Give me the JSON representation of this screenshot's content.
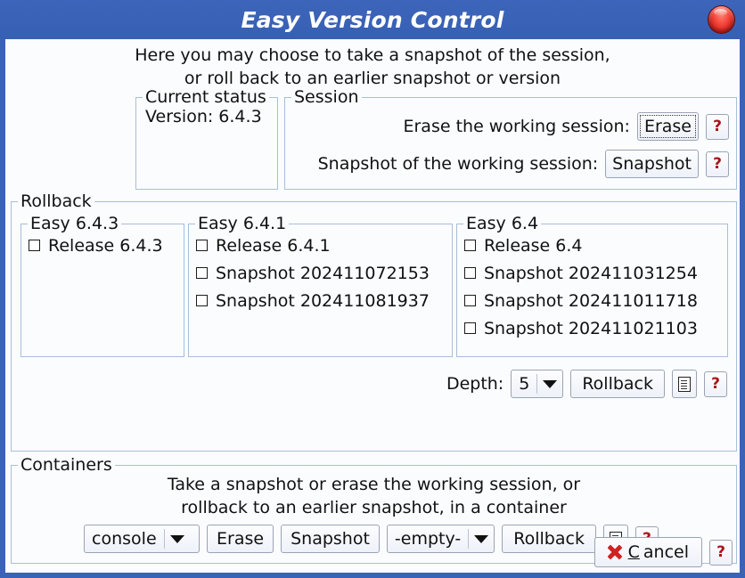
{
  "window": {
    "title": "Easy Version Control",
    "close_icon": "close-gem-icon"
  },
  "intro": {
    "line1": "Here you may choose to take a snapshot of the session,",
    "line2": "or roll back to an earlier snapshot or version"
  },
  "current_status": {
    "legend": "Current status",
    "version": "Version: 6.4.3"
  },
  "session": {
    "legend": "Session",
    "erase_label": "Erase the working session:",
    "erase_button": "Erase",
    "snapshot_label": "Snapshot of the working session:",
    "snapshot_button": "Snapshot",
    "help": "?"
  },
  "rollback": {
    "legend": "Rollback",
    "columns": [
      {
        "legend": "Easy 6.4.3",
        "items": [
          {
            "label": "Release 6.4.3",
            "checked": false
          }
        ]
      },
      {
        "legend": "Easy 6.4.1",
        "items": [
          {
            "label": "Release 6.4.1",
            "checked": false
          },
          {
            "label": "Snapshot 202411072153",
            "checked": false
          },
          {
            "label": "Snapshot 202411081937",
            "checked": false
          }
        ]
      },
      {
        "legend": "Easy 6.4",
        "items": [
          {
            "label": "Release 6.4",
            "checked": false
          },
          {
            "label": "Snapshot 202411031254",
            "checked": false
          },
          {
            "label": "Snapshot 202411011718",
            "checked": false
          },
          {
            "label": "Snapshot 202411021103",
            "checked": false
          }
        ]
      }
    ],
    "depth_label": "Depth:",
    "depth_value": "5",
    "rollback_button": "Rollback",
    "doc_icon": "document-icon",
    "help": "?"
  },
  "containers": {
    "legend": "Containers",
    "line1": "Take a snapshot or erase the working session, or",
    "line2": "rollback to an earlier snapshot, in a container",
    "container_value": "console",
    "erase_button": "Erase",
    "snapshot_button": "Snapshot",
    "snapshot_value": "-empty-",
    "rollback_button": "Rollback",
    "doc_icon": "document-icon",
    "help": "?"
  },
  "footer": {
    "cancel_prefix": "",
    "cancel_accel": "C",
    "cancel_rest": "ancel",
    "help": "?"
  },
  "colors": {
    "titlebar": "#3a63b8",
    "frame": "#3a63b8",
    "client_bg": "#fbfcfe",
    "group_border": "#a8bed8",
    "help_red": "#a81418",
    "cancel_red": "#cf2222"
  }
}
